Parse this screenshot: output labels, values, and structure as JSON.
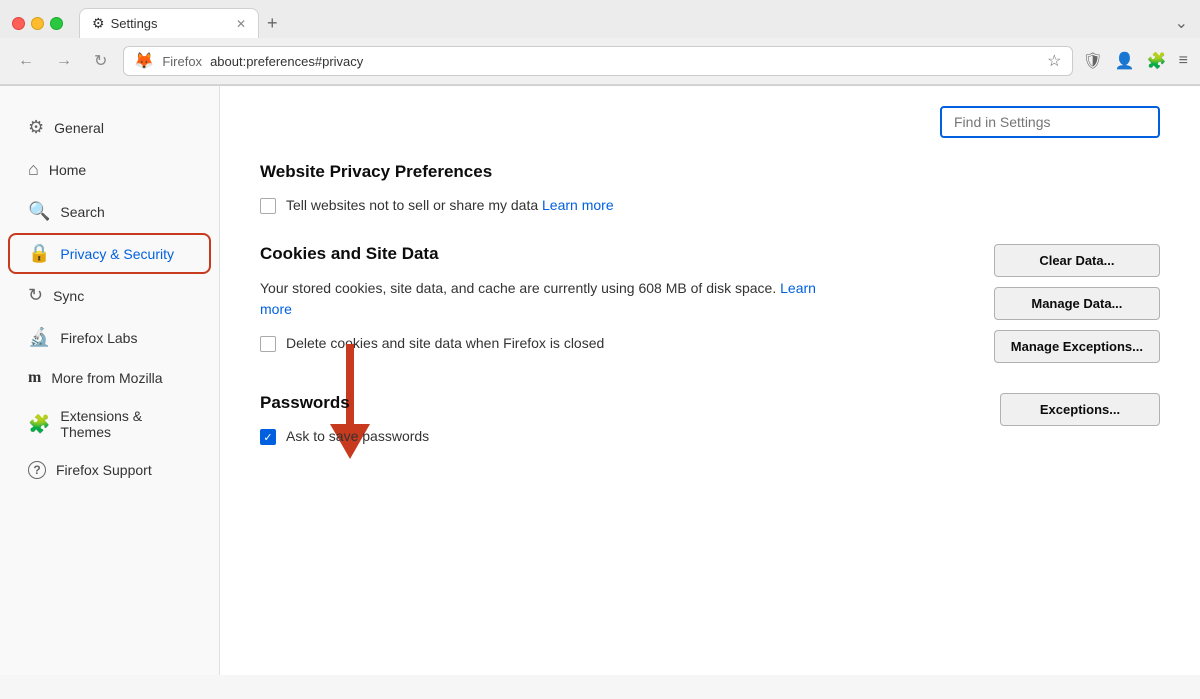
{
  "browser": {
    "tab_icon": "⚙",
    "tab_title": "Settings",
    "tab_close": "✕",
    "new_tab": "+",
    "window_chevron": "⌄",
    "url_firefox": "Firefox",
    "url_address": "about:preferences#privacy",
    "nav_back": "←",
    "nav_forward": "→",
    "nav_refresh": "↻",
    "nav_bookmark": "☆",
    "nav_pocket": "🛡",
    "nav_account": "👤",
    "nav_extensions": "🧩",
    "nav_menu": "≡"
  },
  "search": {
    "placeholder": "Find in Settings"
  },
  "sidebar": {
    "items": [
      {
        "id": "general",
        "label": "General",
        "icon": "⚙"
      },
      {
        "id": "home",
        "label": "Home",
        "icon": "⌂"
      },
      {
        "id": "search",
        "label": "Search",
        "icon": "🔍"
      },
      {
        "id": "privacy",
        "label": "Privacy & Security",
        "icon": "🔒",
        "active": true
      },
      {
        "id": "sync",
        "label": "Sync",
        "icon": "↻"
      },
      {
        "id": "firefox-labs",
        "label": "Firefox Labs",
        "icon": "🔬"
      },
      {
        "id": "mozilla",
        "label": "More from Mozilla",
        "icon": "m"
      },
      {
        "id": "extensions",
        "label": "Extensions & Themes",
        "icon": "🧩"
      },
      {
        "id": "support",
        "label": "Firefox Support",
        "icon": "?"
      }
    ]
  },
  "main": {
    "sections": {
      "website_privacy": {
        "title": "Website Privacy Preferences",
        "checkbox_label": "Tell websites not to sell or share my data",
        "learn_more": "Learn more",
        "checked": false
      },
      "cookies": {
        "title": "Cookies and Site Data",
        "description_1": "Your stored cookies, site data, and cache are currently using",
        "description_2": "608 MB of disk space.",
        "description_learn_more": "Learn more",
        "checkbox_label": "Delete cookies and site data when Firefox is closed",
        "checked": false,
        "buttons": {
          "clear_data": "Clear Data...",
          "manage_data": "Manage Data...",
          "manage_exceptions": "Manage Exceptions..."
        }
      },
      "passwords": {
        "title": "Passwords",
        "checkbox_label": "Ask to save passwords",
        "checked": true,
        "buttons": {
          "exceptions": "Exceptions..."
        }
      }
    }
  }
}
